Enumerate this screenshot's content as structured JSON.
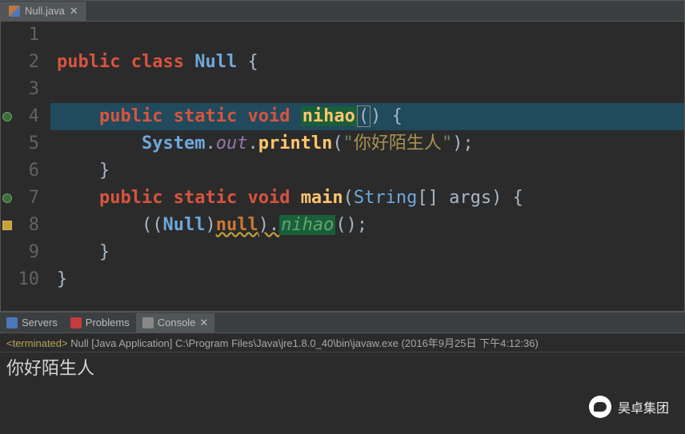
{
  "editor": {
    "tab": {
      "filename": "Null.java"
    },
    "lines": [
      {
        "num": "1",
        "tokens": []
      },
      {
        "num": "2",
        "tokens": [
          {
            "t": "public",
            "c": "kw-red"
          },
          {
            "t": " ",
            "c": ""
          },
          {
            "t": "class",
            "c": "kw-red"
          },
          {
            "t": " ",
            "c": ""
          },
          {
            "t": "Null",
            "c": "cls"
          },
          {
            "t": " ",
            "c": ""
          },
          {
            "t": "{",
            "c": "punct-white"
          }
        ]
      },
      {
        "num": "3",
        "tokens": []
      },
      {
        "num": "4",
        "highlight": true,
        "marker": "circle",
        "tokens": [
          {
            "t": "    ",
            "c": ""
          },
          {
            "t": "public",
            "c": "kw-red"
          },
          {
            "t": " ",
            "c": ""
          },
          {
            "t": "static",
            "c": "kw-red"
          },
          {
            "t": " ",
            "c": ""
          },
          {
            "t": "void",
            "c": "kw-red"
          },
          {
            "t": " ",
            "c": ""
          },
          {
            "t": "nihao",
            "c": "method highlight-box"
          },
          {
            "t": "(",
            "c": "punct-white cursor-box"
          },
          {
            "t": ") ",
            "c": "punct-white"
          },
          {
            "t": "{",
            "c": "punct-white"
          }
        ]
      },
      {
        "num": "5",
        "tokens": [
          {
            "t": "        ",
            "c": ""
          },
          {
            "t": "System",
            "c": "cls"
          },
          {
            "t": ".",
            "c": "punct-white"
          },
          {
            "t": "out",
            "c": "field"
          },
          {
            "t": ".",
            "c": "punct-white"
          },
          {
            "t": "println",
            "c": "method"
          },
          {
            "t": "(",
            "c": "punct-white"
          },
          {
            "t": "\"",
            "c": "str"
          },
          {
            "t": "你好陌生人",
            "c": "str-cn"
          },
          {
            "t": "\"",
            "c": "str"
          },
          {
            "t": ");",
            "c": "punct-white"
          }
        ]
      },
      {
        "num": "6",
        "tokens": [
          {
            "t": "    ",
            "c": ""
          },
          {
            "t": "}",
            "c": "punct-white"
          }
        ]
      },
      {
        "num": "7",
        "marker": "circle",
        "tokens": [
          {
            "t": "    ",
            "c": ""
          },
          {
            "t": "public",
            "c": "kw-red"
          },
          {
            "t": " ",
            "c": ""
          },
          {
            "t": "static",
            "c": "kw-red"
          },
          {
            "t": " ",
            "c": ""
          },
          {
            "t": "void",
            "c": "kw-red"
          },
          {
            "t": " ",
            "c": ""
          },
          {
            "t": "main",
            "c": "method"
          },
          {
            "t": "(",
            "c": "punct-white"
          },
          {
            "t": "String",
            "c": "type"
          },
          {
            "t": "[] ",
            "c": "punct-white"
          },
          {
            "t": "args",
            "c": "param"
          },
          {
            "t": ") ",
            "c": "punct-white"
          },
          {
            "t": "{",
            "c": "punct-white"
          }
        ]
      },
      {
        "num": "8",
        "marker": "warn",
        "tokens": [
          {
            "t": "        ",
            "c": ""
          },
          {
            "t": "((",
            "c": "punct-white"
          },
          {
            "t": "Null",
            "c": "cls"
          },
          {
            "t": ")",
            "c": "punct-white"
          },
          {
            "t": "null",
            "c": "kw underline-wavy"
          },
          {
            "t": ").",
            "c": "punct-white underline-wavy"
          },
          {
            "t": "nihao",
            "c": "method-italic highlight-box"
          },
          {
            "t": "();",
            "c": "punct-white"
          }
        ]
      },
      {
        "num": "9",
        "tokens": [
          {
            "t": "    ",
            "c": ""
          },
          {
            "t": "}",
            "c": "punct-white"
          }
        ]
      },
      {
        "num": "10",
        "tokens": [
          {
            "t": "}",
            "c": "punct-white"
          }
        ]
      }
    ]
  },
  "bottom": {
    "tabs": {
      "servers": "Servers",
      "problems": "Problems",
      "console": "Console"
    },
    "console": {
      "status": "<terminated>",
      "process": " Null [Java Application] C:\\Program Files\\Java\\jre1.8.0_40\\bin\\javaw.exe (2016年9月25日 下午4:12:36)",
      "output": "你好陌生人"
    }
  },
  "watermark": "昊卓集团"
}
